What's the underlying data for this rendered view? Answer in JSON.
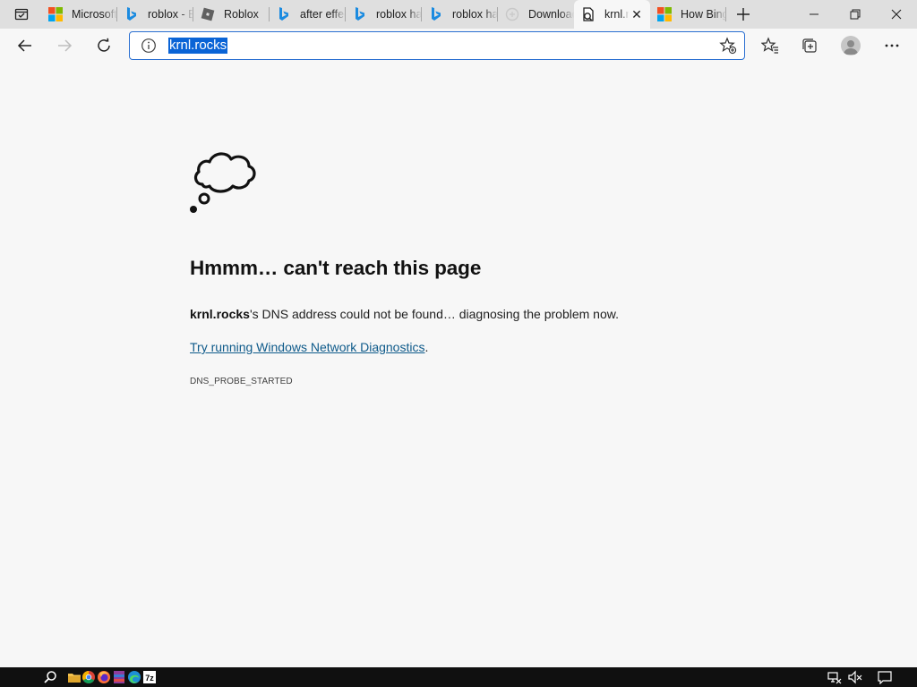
{
  "browser": {
    "tabs": [
      {
        "title": "Microsoft Start",
        "favicon": "microsoft-icon"
      },
      {
        "title": "roblox - Bing",
        "favicon": "bing-icon"
      },
      {
        "title": "Roblox",
        "favicon": "roblox-icon"
      },
      {
        "title": "after effects",
        "favicon": "bing-icon"
      },
      {
        "title": "roblox hacks",
        "favicon": "bing-icon"
      },
      {
        "title": "roblox hacks",
        "favicon": "bing-icon"
      },
      {
        "title": "Download",
        "favicon": "download-page-icon"
      },
      {
        "title": "krnl.rocks",
        "favicon": "error-page-icon",
        "active": true
      },
      {
        "title": "How Bing",
        "favicon": "microsoft-icon"
      }
    ],
    "address_bar": {
      "url": "krnl.rocks"
    },
    "accent": "#0a64d6"
  },
  "error_page": {
    "headline": "Hmmm… can't reach this page",
    "domain": "krnl.rocks",
    "detail_suffix": "'s DNS address could not be found… diagnosing the problem now.",
    "diagnostics_link": "Try running Windows Network Diagnostics",
    "diagnostics_suffix": ".",
    "error_code": "DNS_PROBE_STARTED",
    "link_color": "#0e5a8a"
  },
  "taskbar": {
    "pinned": [
      "search-icon",
      "file-explorer-icon",
      "chrome-icon",
      "firefox-icon",
      "winrar-icon",
      "edge-icon",
      "7zip-icon"
    ],
    "tray": [
      "network-icon",
      "volume-muted-icon",
      "notification-icon"
    ]
  }
}
